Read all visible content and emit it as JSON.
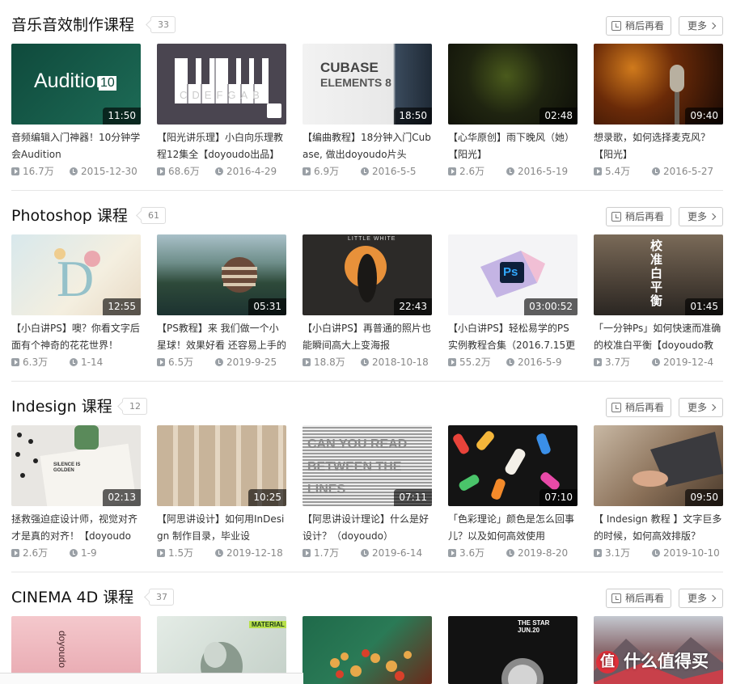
{
  "ui": {
    "watch_later_label": "稍后再看",
    "more_label": "更多",
    "watermark_badge": "值",
    "watermark_text": "什么值得买"
  },
  "sections": [
    {
      "title": "音乐音效制作课程",
      "count": "33",
      "cards": [
        {
          "title": "音频编辑入门神器！10分钟学会Audition",
          "duration": "11:50",
          "views": "16.7万",
          "date": "2015-12-30",
          "art_text": "Audition",
          "art_sub": "10"
        },
        {
          "title": "【阳光讲乐理】小白向乐理教程12集全【doyoudo出品】",
          "duration": "",
          "views": "68.6万",
          "date": "2016-4-29",
          "art_text": "CDEFGAB"
        },
        {
          "title": "【编曲教程】18分钟入门Cubase, 做出doyoudo片头",
          "duration": "18:50",
          "views": "6.9万",
          "date": "2016-5-5",
          "art_text": "CUBASE",
          "art_sub": "ELEMENTS 8"
        },
        {
          "title": "【心华原创】雨下晚风（她）【阳光】",
          "duration": "02:48",
          "views": "2.6万",
          "date": "2016-5-19"
        },
        {
          "title": "想录歌，如何选择麦克风？【阳光】",
          "duration": "09:40",
          "views": "5.4万",
          "date": "2016-5-27"
        }
      ]
    },
    {
      "title": "Photoshop 课程",
      "count": "61",
      "cards": [
        {
          "title": "【小白讲PS】噢？你看文字后面有个神奇的花花世界！",
          "duration": "12:55",
          "views": "6.3万",
          "date": "1-14"
        },
        {
          "title": "【PS教程】来 我们做一个小星球！效果好看 还容易上手的",
          "duration": "05:31",
          "views": "6.5万",
          "date": "2019-9-25"
        },
        {
          "title": "【小白讲PS】再普通的照片也能瞬间高大上变海报",
          "duration": "22:43",
          "views": "18.8万",
          "date": "2018-10-18",
          "art_text": "LITTLE WHITE"
        },
        {
          "title": "【小白讲PS】轻松易学的PS实例教程合集（2016.7.15更",
          "duration": "03:00:52",
          "views": "55.2万",
          "date": "2016-5-9",
          "art_text": "Ps"
        },
        {
          "title": "「一分钟Ps」如何快速而准确的校准白平衡【doyoudo教",
          "duration": "01:45",
          "views": "3.7万",
          "date": "2019-12-4",
          "art_text": "校准白平衡"
        }
      ]
    },
    {
      "title": "Indesign 课程",
      "count": "12",
      "cards": [
        {
          "title": "拯救强迫症设计师，视觉对齐才是真的对齐！【doyoudo",
          "duration": "02:13",
          "views": "2.6万",
          "date": "1-9",
          "art_text": "SILENCE IS GOLDEN"
        },
        {
          "title": "【阿思讲设计】如何用InDesign 制作目录，毕业设",
          "duration": "10:25",
          "views": "1.5万",
          "date": "2019-12-18"
        },
        {
          "title": "【阿思讲设计理论】什么是好设计？（doyoudo）",
          "duration": "07:11",
          "views": "1.7万",
          "date": "2019-6-14",
          "art_text": "CAN YOU READ BETWEEN THE LINES"
        },
        {
          "title": "「色彩理论」颜色是怎么回事儿？以及如何高效使用",
          "duration": "07:10",
          "views": "3.6万",
          "date": "2019-8-20"
        },
        {
          "title": "【 Indesign 教程 】文字巨多的时候，如何高效排版？",
          "duration": "09:50",
          "views": "3.1万",
          "date": "2019-10-10"
        }
      ]
    },
    {
      "title": "CINEMA 4D 课程",
      "count": "37",
      "cards": [
        {
          "title": "",
          "duration": "",
          "views": "",
          "date": "",
          "art_text": "doyoudo"
        },
        {
          "title": "",
          "duration": "",
          "views": "",
          "date": "",
          "art_text": "MATERIAL"
        },
        {
          "title": "",
          "duration": "",
          "views": "",
          "date": ""
        },
        {
          "title": "",
          "duration": "",
          "views": "",
          "date": "",
          "art_text": "THE STAR",
          "art_sub": "JUN.20"
        },
        {
          "title": "",
          "duration": "",
          "views": "",
          "date": ""
        }
      ]
    }
  ]
}
